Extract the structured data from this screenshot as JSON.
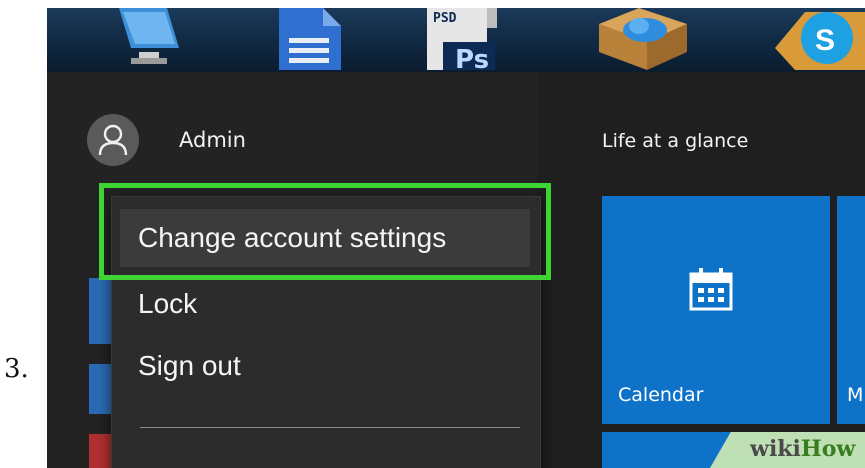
{
  "step": {
    "number": "3."
  },
  "desktop": {
    "icons": [
      "monitor-icon",
      "document-icon",
      "photoshop-file-icon",
      "cloud-box-icon",
      "skype-icon"
    ],
    "photoshop_label_top": "PSD",
    "photoshop_label_bottom": "Ps"
  },
  "start_menu": {
    "account": {
      "name": "Admin",
      "icon": "user-icon"
    },
    "flyout": {
      "items": [
        {
          "label": "Change account settings",
          "highlighted": true
        },
        {
          "label": "Lock"
        },
        {
          "label": "Sign out"
        }
      ]
    },
    "tiles": {
      "group_title": "Life at a glance",
      "calendar": {
        "label": "Calendar",
        "icon": "calendar-icon",
        "color": "#0e72c9"
      },
      "partial_label": "M"
    }
  },
  "annotation": {
    "color": "#3ed534"
  },
  "watermark": {
    "part1": "wiki",
    "part2": "How"
  }
}
